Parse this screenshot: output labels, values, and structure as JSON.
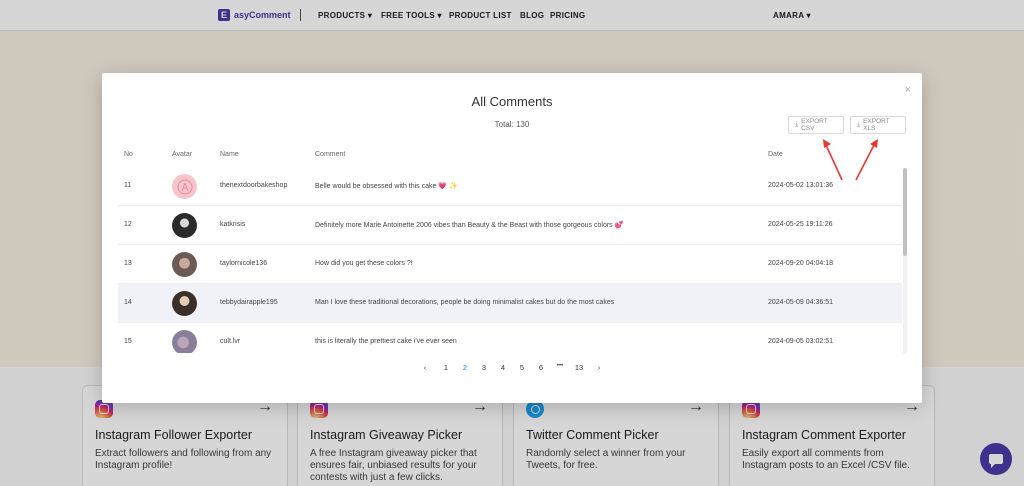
{
  "nav": {
    "logo_mark": "E",
    "logo_text": "asyComment",
    "items": [
      "PRODUCTS ▾",
      "FREE TOOLS ▾",
      "PRODUCT LIST",
      "BLOG",
      "PRICING"
    ],
    "user": "AMARA ▾"
  },
  "modal": {
    "title": "All Comments",
    "total": "Total: 130",
    "close_icon": "×",
    "export_csv": "EXPORT CSV",
    "export_xls": "EXPORT XLS",
    "download_icon": "⤓"
  },
  "table": {
    "headers": [
      "No",
      "Avatar",
      "Name",
      "Comment",
      "Date"
    ],
    "rows": [
      {
        "no": "11",
        "name": "thenextdoorbakeshop",
        "comment": "Belle would be obsessed with this cake 💗 ✨",
        "date": "2024-05-02 13:01:36",
        "avatar_color": "#f4c6cc"
      },
      {
        "no": "12",
        "name": "katkrisis",
        "comment": "Definitely more Marie Antoinette 2006 vibes than Beauty & the Beast with those gorgeous colors 💕",
        "date": "2024-05-25 19:11:26",
        "avatar_color": "#2b2b2b"
      },
      {
        "no": "13",
        "name": "taylornicole136",
        "comment": "How did you get these colors ?!",
        "date": "2024-09-20 04:04:18",
        "avatar_color": "#6b5a55"
      },
      {
        "no": "14",
        "name": "tebbydairapple195",
        "comment": "Man I love these traditional decorations, people be doing minimalist cakes but do the most cakes",
        "date": "2024-05-09 04:36:51",
        "avatar_color": "#3a2f2a"
      },
      {
        "no": "15",
        "name": "cult.lvr",
        "comment": "this is literally the prettiest cake i've ever seen",
        "date": "2024-09-05 03:02:51",
        "avatar_color": "#8a7f9a"
      }
    ]
  },
  "pagination": {
    "prev": "‹",
    "pages": [
      "1",
      "2",
      "3",
      "4",
      "5",
      "6",
      "•••",
      "13"
    ],
    "active": "2",
    "next": "›"
  },
  "cards": [
    {
      "title": "Instagram Follower Exporter",
      "desc": "Extract followers and following from any Instagram profile!",
      "icon": "instagram-icon"
    },
    {
      "title": "Instagram Giveaway Picker",
      "desc": "A free Instagram giveaway picker that ensures fair, unbiased results for your contests with just a few clicks.",
      "icon": "instagram-icon"
    },
    {
      "title": "Twitter Comment Picker",
      "desc": "Randomly select a winner from your Tweets, for free.",
      "icon": "twitter-icon"
    },
    {
      "title": "Instagram Comment Exporter",
      "desc": "Easily export all comments from Instagram posts to an Excel /CSV file.",
      "icon": "instagram-icon"
    }
  ],
  "card_arrow": "→",
  "colors": {
    "brand": "#4a3aa8",
    "active_page": "#1e88e5",
    "annotation": "#e53935"
  }
}
